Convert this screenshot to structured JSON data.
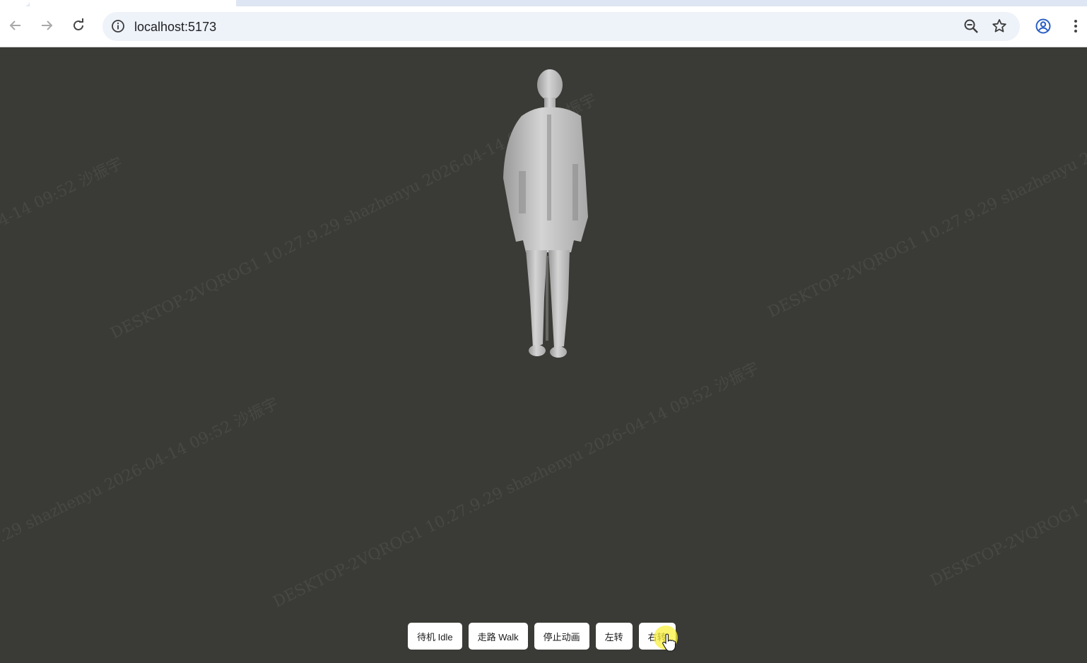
{
  "browser": {
    "url": "localhost:5173",
    "icons": {
      "back": "arrow-left-icon",
      "forward": "arrow-right-icon",
      "reload": "reload-icon",
      "site_info": "info-icon",
      "zoom": "zoom-out-icon",
      "bookmark": "star-icon",
      "profile": "account-icon",
      "menu": "kebab-menu-icon"
    }
  },
  "scene": {
    "background": "#3a3a36",
    "model_color": "#c8c8c8"
  },
  "controls": [
    {
      "label": "待机 Idle"
    },
    {
      "label": "走路 Walk"
    },
    {
      "label": "停止动画"
    },
    {
      "label": "左转"
    },
    {
      "label": "右转"
    }
  ],
  "watermark": {
    "text": "DESKTOP-2VQROG1 10.27.9.29 shazhenyu 2026-04-14 09:52 沙振宇"
  }
}
